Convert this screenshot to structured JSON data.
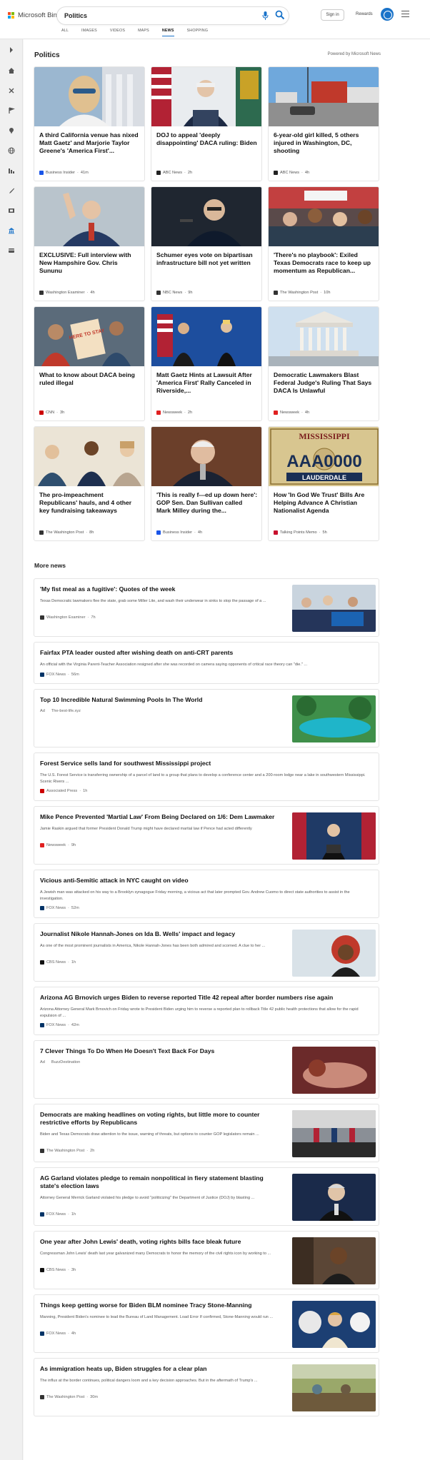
{
  "header": {
    "logo_text": "Microsoft Bing",
    "search_value": "Politics",
    "signin_label": "Sign in",
    "rewards_label": "Rewards",
    "tabs": [
      {
        "label": "ALL",
        "active": false
      },
      {
        "label": "IMAGES",
        "active": false
      },
      {
        "label": "VIDEOS",
        "active": false
      },
      {
        "label": "MAPS",
        "active": false
      },
      {
        "label": "NEWS",
        "active": true
      },
      {
        "label": "SHOPPING",
        "active": false
      }
    ]
  },
  "rail": {
    "icons": [
      "chevron-right-icon",
      "home-icon",
      "tools-icon",
      "flag-icon",
      "pin-icon",
      "globe-icon",
      "chart-icon",
      "rocket-icon",
      "film-icon",
      "bank-icon",
      "card-icon"
    ]
  },
  "politics": {
    "title": "Politics",
    "powered_by": "Powered by Microsoft News",
    "cards": [
      {
        "title": "A third California venue has nixed Matt Gaetz' and Marjorie Taylor Greene's 'America First'...",
        "source": "Business Insider",
        "time": "41m",
        "src_color": "#1a55e8"
      },
      {
        "title": "DOJ to appeal 'deeply disappointing' DACA ruling: Biden",
        "source": "ABC News",
        "time": "2h",
        "src_color": "#222222"
      },
      {
        "title": "6-year-old girl killed, 5 others injured in Washington, DC, shooting",
        "source": "ABC News",
        "time": "4h",
        "src_color": "#222222"
      },
      {
        "title": "EXCLUSIVE: Full interview with New Hampshire Gov. Chris Sununu",
        "source": "Washington Examiner",
        "time": "4h",
        "src_color": "#333333"
      },
      {
        "title": "Schumer eyes vote on bipartisan infrastructure bill not yet written",
        "source": "NBC News",
        "time": "9h",
        "src_color": "#333333"
      },
      {
        "title": "'There's no playbook': Exiled Texas Democrats race to keep up momentum as Republican...",
        "source": "The Washington Post",
        "time": "10h",
        "src_color": "#333333"
      },
      {
        "title": "What to know about DACA being ruled illegal",
        "source": "CNN",
        "time": "3h",
        "src_color": "#cc0000"
      },
      {
        "title": "Matt Gaetz Hints at Lawsuit After 'America First' Rally Canceled in Riverside,...",
        "source": "Newsweek",
        "time": "2h",
        "src_color": "#e02020"
      },
      {
        "title": "Democratic Lawmakers Blast Federal Judge's Ruling That Says DACA Is Unlawful",
        "source": "Newsweek",
        "time": "4h",
        "src_color": "#e02020"
      },
      {
        "title": "The pro-impeachment Republicans' hauls, and 4 other key fundraising takeaways",
        "source": "The Washington Post",
        "time": "8h",
        "src_color": "#333333"
      },
      {
        "title": "'This is really f---ed up down here': GOP Sen. Dan Sullivan called Mark Milley during the...",
        "source": "Business Insider",
        "time": "4h",
        "src_color": "#1a55e8"
      },
      {
        "title": "How 'In God We Trust' Bills Are Helping Advance A Christian Nationalist Agenda",
        "source": "Talking Points Memo",
        "time": "5h",
        "src_color": "#c8102e"
      }
    ],
    "plate_text": "MISSISSIPPI",
    "plate_number": "AAA0000",
    "plate_county": "LAUDERDALE",
    "sign_text": "HERE TO STAY"
  },
  "more_news": {
    "title": "More news",
    "items": [
      {
        "title": "'My fist meal as a fugitive': Quotes of the week",
        "desc": "Texas Democratic lawmakers flee the state, grab some Miller Lite, and wash their underwear in sinks to stop the passage of a ...",
        "source": "Washington Examiner",
        "time": "7h",
        "src_color": "#333333",
        "ad": false
      },
      {
        "title": "Fairfax PTA leader ousted after wishing death on anti-CRT parents",
        "desc": "An official with the Virginia Parent-Teacher Association resigned after she was recorded on camera saying opponents of critical race theory can \"die.\" ...",
        "source": "FOX News",
        "time": "56m",
        "src_color": "#003366",
        "ad": false
      },
      {
        "title": "Top 10 Incredible Natural Swimming Pools In The World",
        "desc": "",
        "source": "The-best-life.xyz",
        "time": "",
        "src_color": "",
        "ad": true,
        "ad_label": "Ad"
      },
      {
        "title": "Forest Service sells land for southwest Mississippi project",
        "desc": "The U.S. Forest Service is transferring ownership of a parcel of land to a group that plans to develop a conference center and a 200-room lodge near a lake in southwestern Mississippi. Scenic Rivers ...",
        "source": "Associated Press",
        "time": "1h",
        "src_color": "#cc0000",
        "ad": false
      },
      {
        "title": "Mike Pence Prevented 'Martial Law' From Being Declared on 1/6: Dem Lawmaker",
        "desc": "Jamie Raskin argued that former President Donald Trump might have declared martial law if Pence had acted differently",
        "source": "Newsweek",
        "time": "9h",
        "src_color": "#e02020",
        "ad": false
      },
      {
        "title": "Vicious anti-Semitic attack in NYC caught on video",
        "desc": "A Jewish man was attacked on his way to a Brooklyn synagogue Friday morning, a vicious act that later prompted Gov. Andrew Cuomo to direct state authorities to assist in the investigation.",
        "source": "FOX News",
        "time": "52m",
        "src_color": "#003366",
        "ad": false
      },
      {
        "title": "Journalist Nikole Hannah-Jones on Ida B. Wells' impact and legacy",
        "desc": "As one of the most prominent journalists in America, Nikole Hannah-Jones has been both admired and scorned. A clue to her ...",
        "source": "CBS News",
        "time": "1h",
        "src_color": "#111111",
        "ad": false
      },
      {
        "title": "Arizona AG Brnovich urges Biden to reverse reported Title 42 repeal after border numbers rise again",
        "desc": "Arizona Attorney General Mark Brnovich on Friday wrote to President Biden urging him to reverse a reported plan to rollback Title 42 public health protections that allow for the rapid expulsion of ...",
        "source": "FOX News",
        "time": "42m",
        "src_color": "#003366",
        "ad": false
      },
      {
        "title": "7 Clever Things To Do When He Doesn't Text Back For Days",
        "desc": "",
        "source": "BuzzDestination",
        "time": "",
        "src_color": "",
        "ad": true,
        "ad_label": "Ad"
      },
      {
        "title": "Democrats are making headlines on voting rights, but little more to counter restrictive efforts by Republicans",
        "desc": "Biden and Texas Democrats draw attention to the issue, warning of threats, but options to counter GOP legislators remain ...",
        "source": "The Washington Post",
        "time": "2h",
        "src_color": "#333333",
        "ad": false
      },
      {
        "title": "AG Garland violates pledge to remain nonpolitical in fiery statement blasting state's election laws",
        "desc": "Attorney General Merrick Garland violated his pledge to avoid \"politicizing\" the Department of Justice (DOJ) by blasting ...",
        "source": "FOX News",
        "time": "1h",
        "src_color": "#003366",
        "ad": false
      },
      {
        "title": "One year after John Lewis' death, voting rights bills face bleak future",
        "desc": "Congressman John Lewis' death last year galvanized many Democrats to honor the memory of the civil rights icon by working to ...",
        "source": "CBS News",
        "time": "3h",
        "src_color": "#111111",
        "ad": false
      },
      {
        "title": "Things keep getting worse for Biden BLM nominee Tracy Stone-Manning",
        "desc": "Manning, President Biden's nominee to lead the Bureau of Land Management. Load Error If confirmed, Stone-Manning would run ...",
        "source": "FOX News",
        "time": "4h",
        "src_color": "#003366",
        "ad": false
      },
      {
        "title": "As immigration heats up, Biden struggles for a clear plan",
        "desc": "The influx at the border continues, political dangers loom and a key decision approaches. But in the aftermath of Trump's ...",
        "source": "The Washington Post",
        "time": "30m",
        "src_color": "#333333",
        "ad": false
      }
    ]
  },
  "colors": {
    "accent": "#1a73c9",
    "logo_red": "#f25022",
    "logo_green": "#7fba00",
    "logo_blue": "#00a4ef",
    "logo_yellow": "#ffb900"
  }
}
